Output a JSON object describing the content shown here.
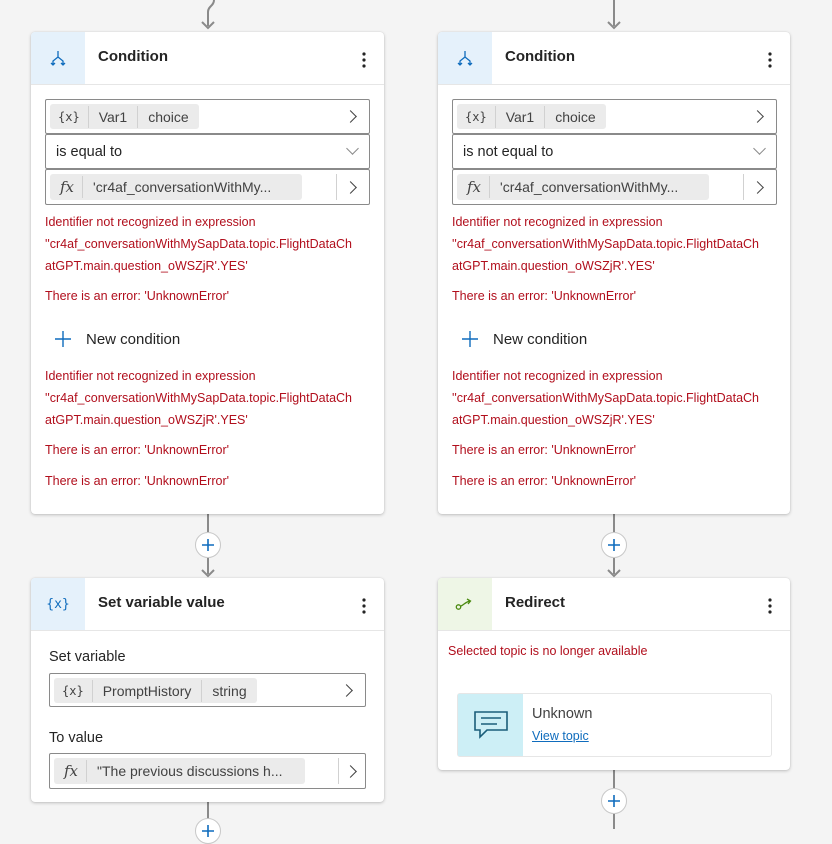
{
  "left_condition": {
    "title": "Condition",
    "variable": {
      "name": "Var1",
      "type": "choice"
    },
    "operator": "is equal to",
    "expression": "'cr4af_conversationWithMy...",
    "errors_block1": {
      "line1": "Identifier not recognized in expression",
      "line2": "''cr4af_conversationWithMySapData.topic.FlightDataCh",
      "line3": "atGPT.main.question_oWSZjR'.YES'",
      "line4": "There is an error: 'UnknownError'"
    },
    "new_condition": "New condition",
    "errors_block2": {
      "line1": "Identifier not recognized in expression",
      "line2": "''cr4af_conversationWithMySapData.topic.FlightDataCh",
      "line3": "atGPT.main.question_oWSZjR'.YES'",
      "line4": "There is an error: 'UnknownError'",
      "line5": "There is an error: 'UnknownError'"
    }
  },
  "right_condition": {
    "title": "Condition",
    "variable": {
      "name": "Var1",
      "type": "choice"
    },
    "operator": "is not equal to",
    "expression": "'cr4af_conversationWithMy...",
    "errors_block1": {
      "line1": "Identifier not recognized in expression",
      "line2": "''cr4af_conversationWithMySapData.topic.FlightDataCh",
      "line3": "atGPT.main.question_oWSZjR'.YES'",
      "line4": "There is an error: 'UnknownError'"
    },
    "new_condition": "New condition",
    "errors_block2": {
      "line1": "Identifier not recognized in expression",
      "line2": "''cr4af_conversationWithMySapData.topic.FlightDataCh",
      "line3": "atGPT.main.question_oWSZjR'.YES'",
      "line4": "There is an error: 'UnknownError'",
      "line5": "There is an error: 'UnknownError'"
    }
  },
  "set_variable": {
    "title": "Set variable value",
    "set_label": "Set variable",
    "variable": {
      "name": "PromptHistory",
      "type": "string"
    },
    "to_value_label": "To value",
    "value_expression": "\"The previous discussions h..."
  },
  "redirect": {
    "title": "Redirect",
    "error": "Selected topic is no longer available",
    "topic_name": "Unknown",
    "view_topic": "View topic"
  },
  "icons": {
    "condition": "branch-icon",
    "variable": "variable-icon",
    "formula": "fx-icon",
    "redirect": "redirect-icon",
    "topic": "chat-message-icon",
    "more": "more-vertical-icon",
    "add": "add-icon"
  },
  "colors": {
    "error": "#b10e1c",
    "condition_icon_bg": "#e5f1fb",
    "redirect_icon_bg": "#eef6e6",
    "topic_icon_bg": "#cdeff6",
    "link": "#0f6cbd"
  }
}
